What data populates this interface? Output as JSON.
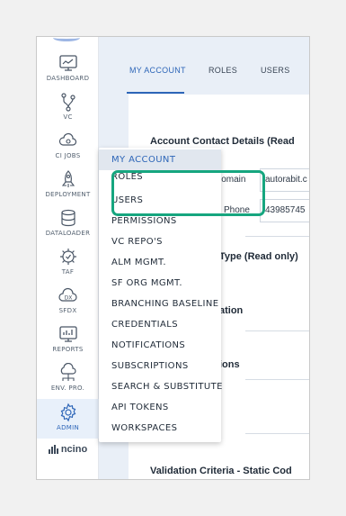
{
  "sidebar": {
    "items": [
      {
        "label": "DASHBOARD",
        "icon": "dashboard-icon"
      },
      {
        "label": "VC",
        "icon": "vc-branch-icon"
      },
      {
        "label": "CI JOBS",
        "icon": "ci-cloud-icon"
      },
      {
        "label": "DEPLOYMENT",
        "icon": "rocket-icon"
      },
      {
        "label": "DATALOADER",
        "icon": "database-icon"
      },
      {
        "label": "TAF",
        "icon": "gear-check-icon"
      },
      {
        "label": "SFDX",
        "icon": "dx-cloud-icon"
      },
      {
        "label": "REPORTS",
        "icon": "report-icon"
      },
      {
        "label": "ENV. PRO.",
        "icon": "network-cloud-icon"
      },
      {
        "label": "ADMIN",
        "icon": "admin-gear-icon"
      }
    ],
    "brand": "ncino"
  },
  "tabs": [
    {
      "label": "MY ACCOUNT",
      "active": true
    },
    {
      "label": "ROLES",
      "active": false
    },
    {
      "label": "USERS",
      "active": false
    }
  ],
  "content": {
    "account_contact_title": "Account Contact Details (Read",
    "domain_label": "Domain",
    "domain_value": "autorabit.c",
    "phone_label": "Phone",
    "phone_value": "43985745",
    "type_title": "Type (Read only)",
    "ation_text": "ation",
    "ions_text": "ions",
    "validation_title": "Validation Criteria - Static Cod"
  },
  "menu": {
    "items": [
      {
        "label": "MY ACCOUNT",
        "selected": true
      },
      {
        "label": "ROLES",
        "selected": false,
        "partial": true
      },
      {
        "label": "USERS",
        "selected": false
      },
      {
        "label": "PERMISSIONS",
        "selected": false
      },
      {
        "label": "VC REPO'S",
        "selected": false
      },
      {
        "label": "ALM MGMT.",
        "selected": false
      },
      {
        "label": "SF ORG MGMT.",
        "selected": false
      },
      {
        "label": "BRANCHING BASELINE",
        "selected": false
      },
      {
        "label": "CREDENTIALS",
        "selected": false
      },
      {
        "label": "NOTIFICATIONS",
        "selected": false
      },
      {
        "label": "SUBSCRIPTIONS",
        "selected": false
      },
      {
        "label": "SEARCH & SUBSTITUTE",
        "selected": false
      },
      {
        "label": "API TOKENS",
        "selected": false
      },
      {
        "label": "WORKSPACES",
        "selected": false
      }
    ]
  },
  "colors": {
    "accent": "#2e66b8",
    "highlight": "#16a67f",
    "panel_bg": "#e9eff7"
  }
}
